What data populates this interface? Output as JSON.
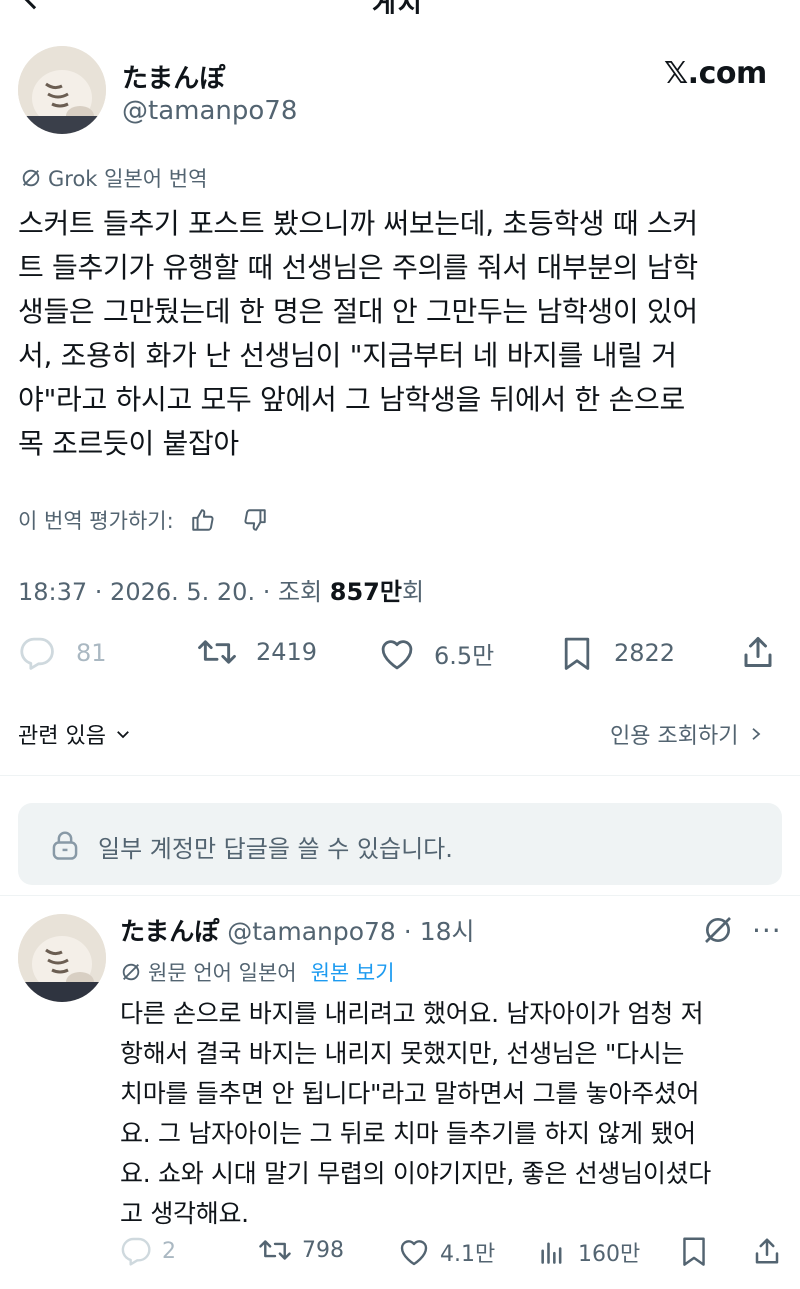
{
  "header": {
    "title": "게시"
  },
  "post": {
    "author_name": "たまんぽ",
    "author_handle": "@tamanpo78",
    "source": "𝕏.com",
    "translation_label": "Grok 일본어 번역",
    "lines": [
      "스커트 들추기 포스트 봤으니까 써보는데, 초등학생 때 스커",
      "트 들추기가 유행할 때 선생님은 주의를 줘서 대부분의 남학",
      "생들은 그만뒀는데 한 명은 절대 안 그만두는 남학생이 있어",
      "서, 조용히 화가 난 선생님이 \"지금부터 네 바지를 내릴 거",
      "야\"라고 하시고 모두 앞에서 그 남학생을 뒤에서 한 손으로",
      "목 조르듯이 붙잡아"
    ],
    "rate_label": "이 번역 평가하기:",
    "time": "18:37 · 2026. 5. 20. · 조회 ",
    "views": "857만",
    "views_suffix": "회",
    "stats": {
      "replies": "81",
      "reposts": "2419",
      "likes": "6.5만",
      "bookmarks": "2822"
    },
    "related_label": "관련 있음",
    "quotes_label": "인용 조회하기"
  },
  "reply_restriction": "일부 계정만 답글을 쓸 수 있습니다.",
  "reply": {
    "author_name": "たまんぽ",
    "author_handle": "@tamanpo78",
    "time": "· 18시",
    "original_lang": "원문 언어 일본어",
    "show_original": "원본 보기",
    "lines": [
      "다른 손으로 바지를 내리려고 했어요. 남자아이가 엄청 저",
      "항해서 결국 바지는 내리지 못했지만, 선생님은 \"다시는",
      "치마를 들추면 안 됩니다\"라고 말하면서 그를 놓아주셨어",
      "요. 그 남자아이는 그 뒤로 치마 들추기를 하지 않게 됐어",
      "요. 쇼와 시대 말기 무렵의 이야기지만, 좋은 선생님이셨다",
      "고 생각해요."
    ],
    "stats": {
      "replies": "2",
      "reposts": "798",
      "likes": "4.1만",
      "views": "160만"
    }
  }
}
